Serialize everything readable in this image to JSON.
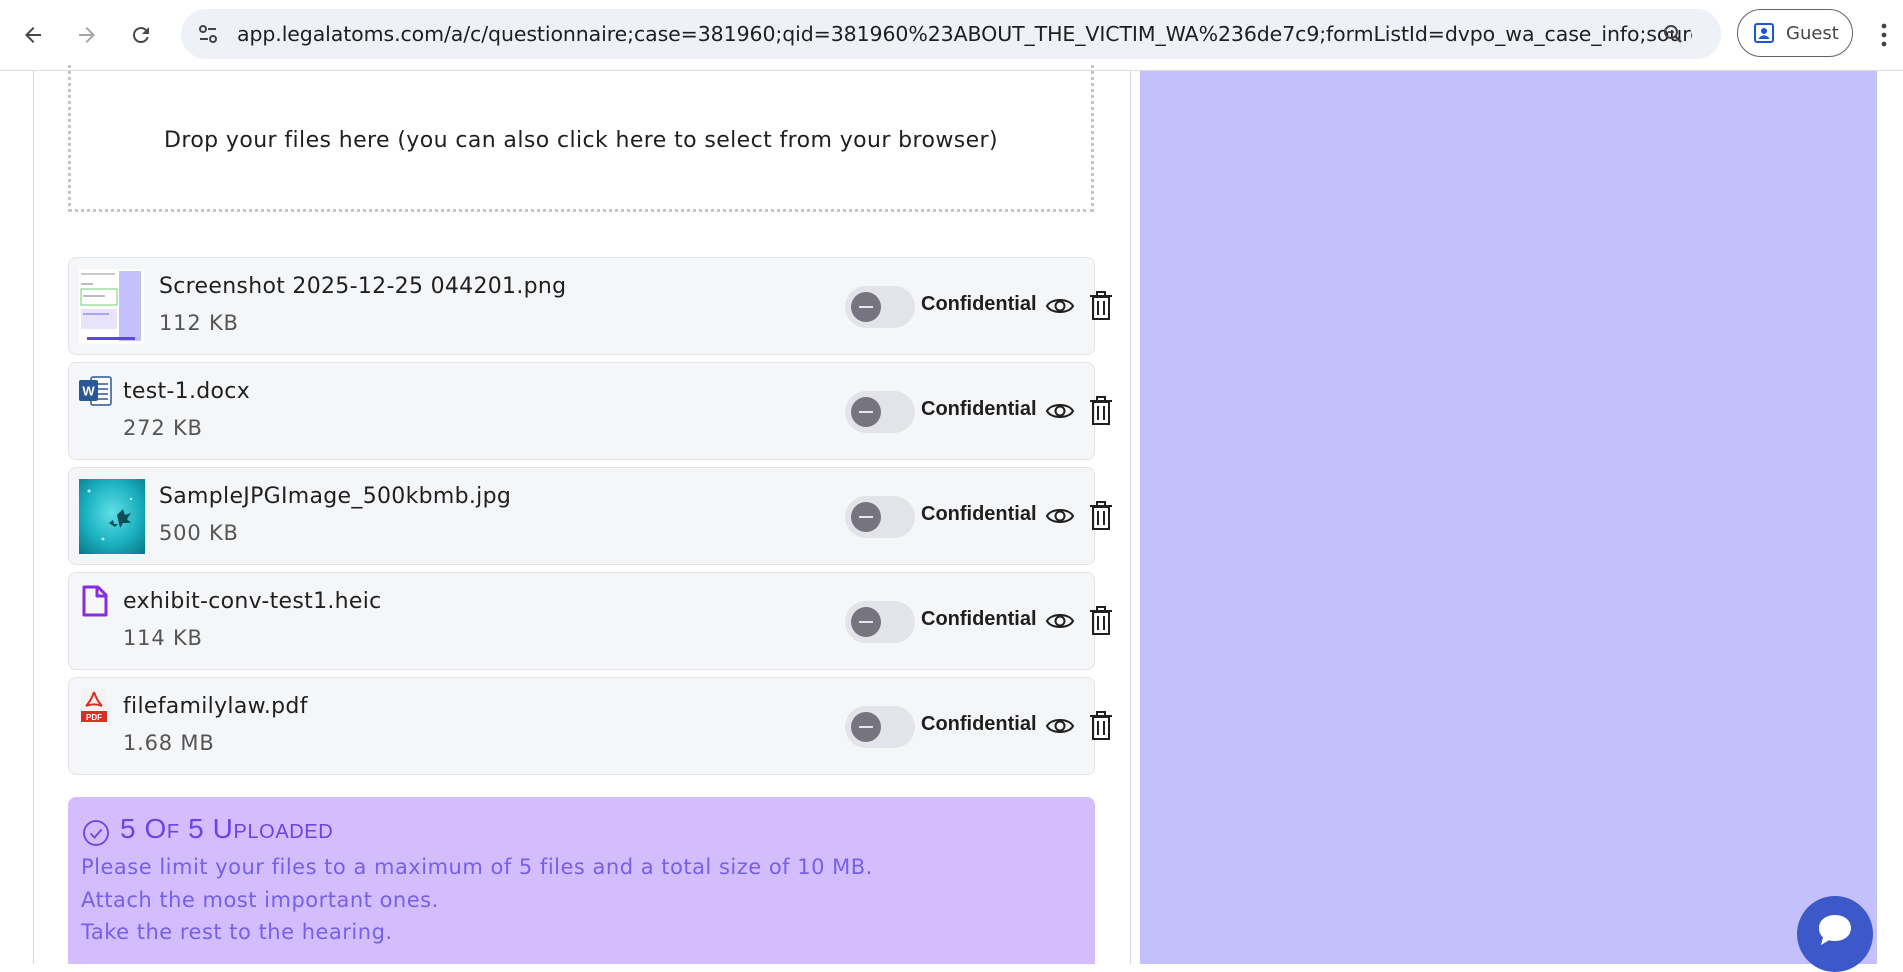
{
  "browser": {
    "url": "app.legalatoms.com/a/c/questionnaire;case=381960;qid=381960%23ABOUT_THE_VICTIM_WA%236de7c9;formListId=dvpo_wa_case_info;source=dvpo...",
    "profile_label": "Guest"
  },
  "dropzone": {
    "text": "Drop your files here (you can also click here to select from your browser)"
  },
  "files": [
    {
      "name": "Screenshot 2025-12-25 044201.png",
      "size": "112 KB",
      "icon": "image-thumbnail",
      "confidential_label": "Confidential"
    },
    {
      "name": "test-1.docx",
      "size": "272 KB",
      "icon": "word-document-icon",
      "confidential_label": "Confidential"
    },
    {
      "name": "SampleJPGImage_500kbmb.jpg",
      "size": "500 KB",
      "icon": "image-thumbnail",
      "confidential_label": "Confidential"
    },
    {
      "name": "exhibit-conv-test1.heic",
      "size": "114 KB",
      "icon": "file-icon",
      "confidential_label": "Confidential"
    },
    {
      "name": "filefamilylaw.pdf",
      "size": "1.68 MB",
      "icon": "pdf-icon",
      "confidential_label": "Confidential"
    }
  ],
  "summary": {
    "title": "5 Of 5 Uploaded",
    "lines": [
      "Please limit your files to a maximum of 5 files and a total size of 10 MB.",
      "Attach the most important ones.",
      "Take the rest to the hearing."
    ]
  },
  "colors": {
    "side_panel": "#c4c0fb",
    "summary_bg": "#d3bdfc",
    "summary_text": "#7660ea",
    "chat_button": "#3d59c9"
  }
}
